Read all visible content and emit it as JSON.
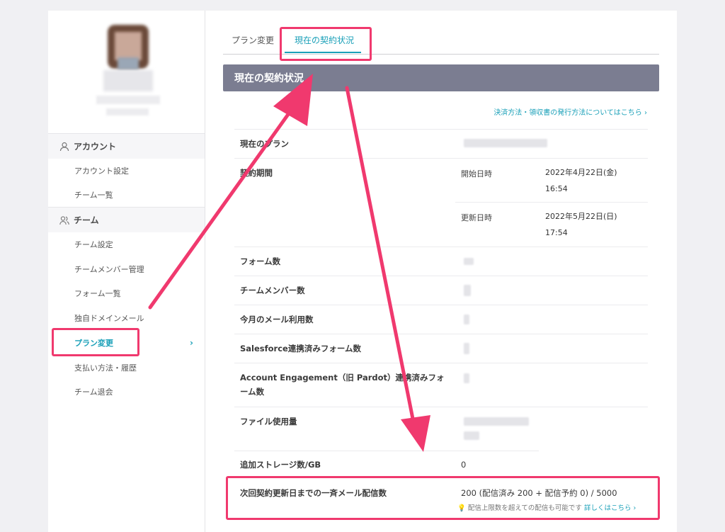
{
  "sidebar": {
    "sections": [
      {
        "label": "アカウント",
        "icon": "user-icon",
        "items": [
          "アカウント設定",
          "チーム一覧"
        ]
      },
      {
        "label": "チーム",
        "icon": "users-icon",
        "items": [
          "チーム設定",
          "チームメンバー管理",
          "フォーム一覧",
          "独自ドメインメール",
          "プラン変更",
          "支払い方法・履歴",
          "チーム退会"
        ]
      }
    ],
    "active_item": "プラン変更"
  },
  "tabs": [
    "プラン変更",
    "現在の契約状況"
  ],
  "active_tab": "現在の契約状況",
  "banner_title": "現在の契約状況",
  "help_link": "決済方法・領収書の発行方法についてはこちら ›",
  "rows": [
    {
      "label": "現在のプラン",
      "value": ""
    },
    {
      "label": "契約期間",
      "value": ""
    },
    {
      "label": "フォーム数",
      "value": ""
    },
    {
      "label": "チームメンバー数",
      "value": ""
    },
    {
      "label": "今月のメール利用数",
      "value": ""
    },
    {
      "label": "Salesforce連携済みフォーム数",
      "value": ""
    },
    {
      "label": "Account Engagement（旧 Pardot）連携済みフォーム数",
      "value": ""
    },
    {
      "label": "ファイル使用量",
      "value": ""
    },
    {
      "label": "追加ストレージ数/GB",
      "value": "0"
    },
    {
      "label": "次回契約更新日までの一斉メール配信数",
      "value": "200 (配信済み 200 + 配信予約 0) / 5000"
    }
  ],
  "contract_period": {
    "start_label": "開始日時",
    "start_date": "2022年4月22日(金)",
    "start_time": "16:54",
    "renew_label": "更新日時",
    "renew_date": "2022年5月22日(日)",
    "renew_time": "17:54"
  },
  "note": {
    "icon": "lightbulb-icon",
    "text": "配信上限数を超えての配信も可能です",
    "link": "詳しくはこちら ›"
  },
  "colors": {
    "accent": "#1aa0b8",
    "banner": "#7b7d91",
    "highlight": "#f0396e"
  }
}
